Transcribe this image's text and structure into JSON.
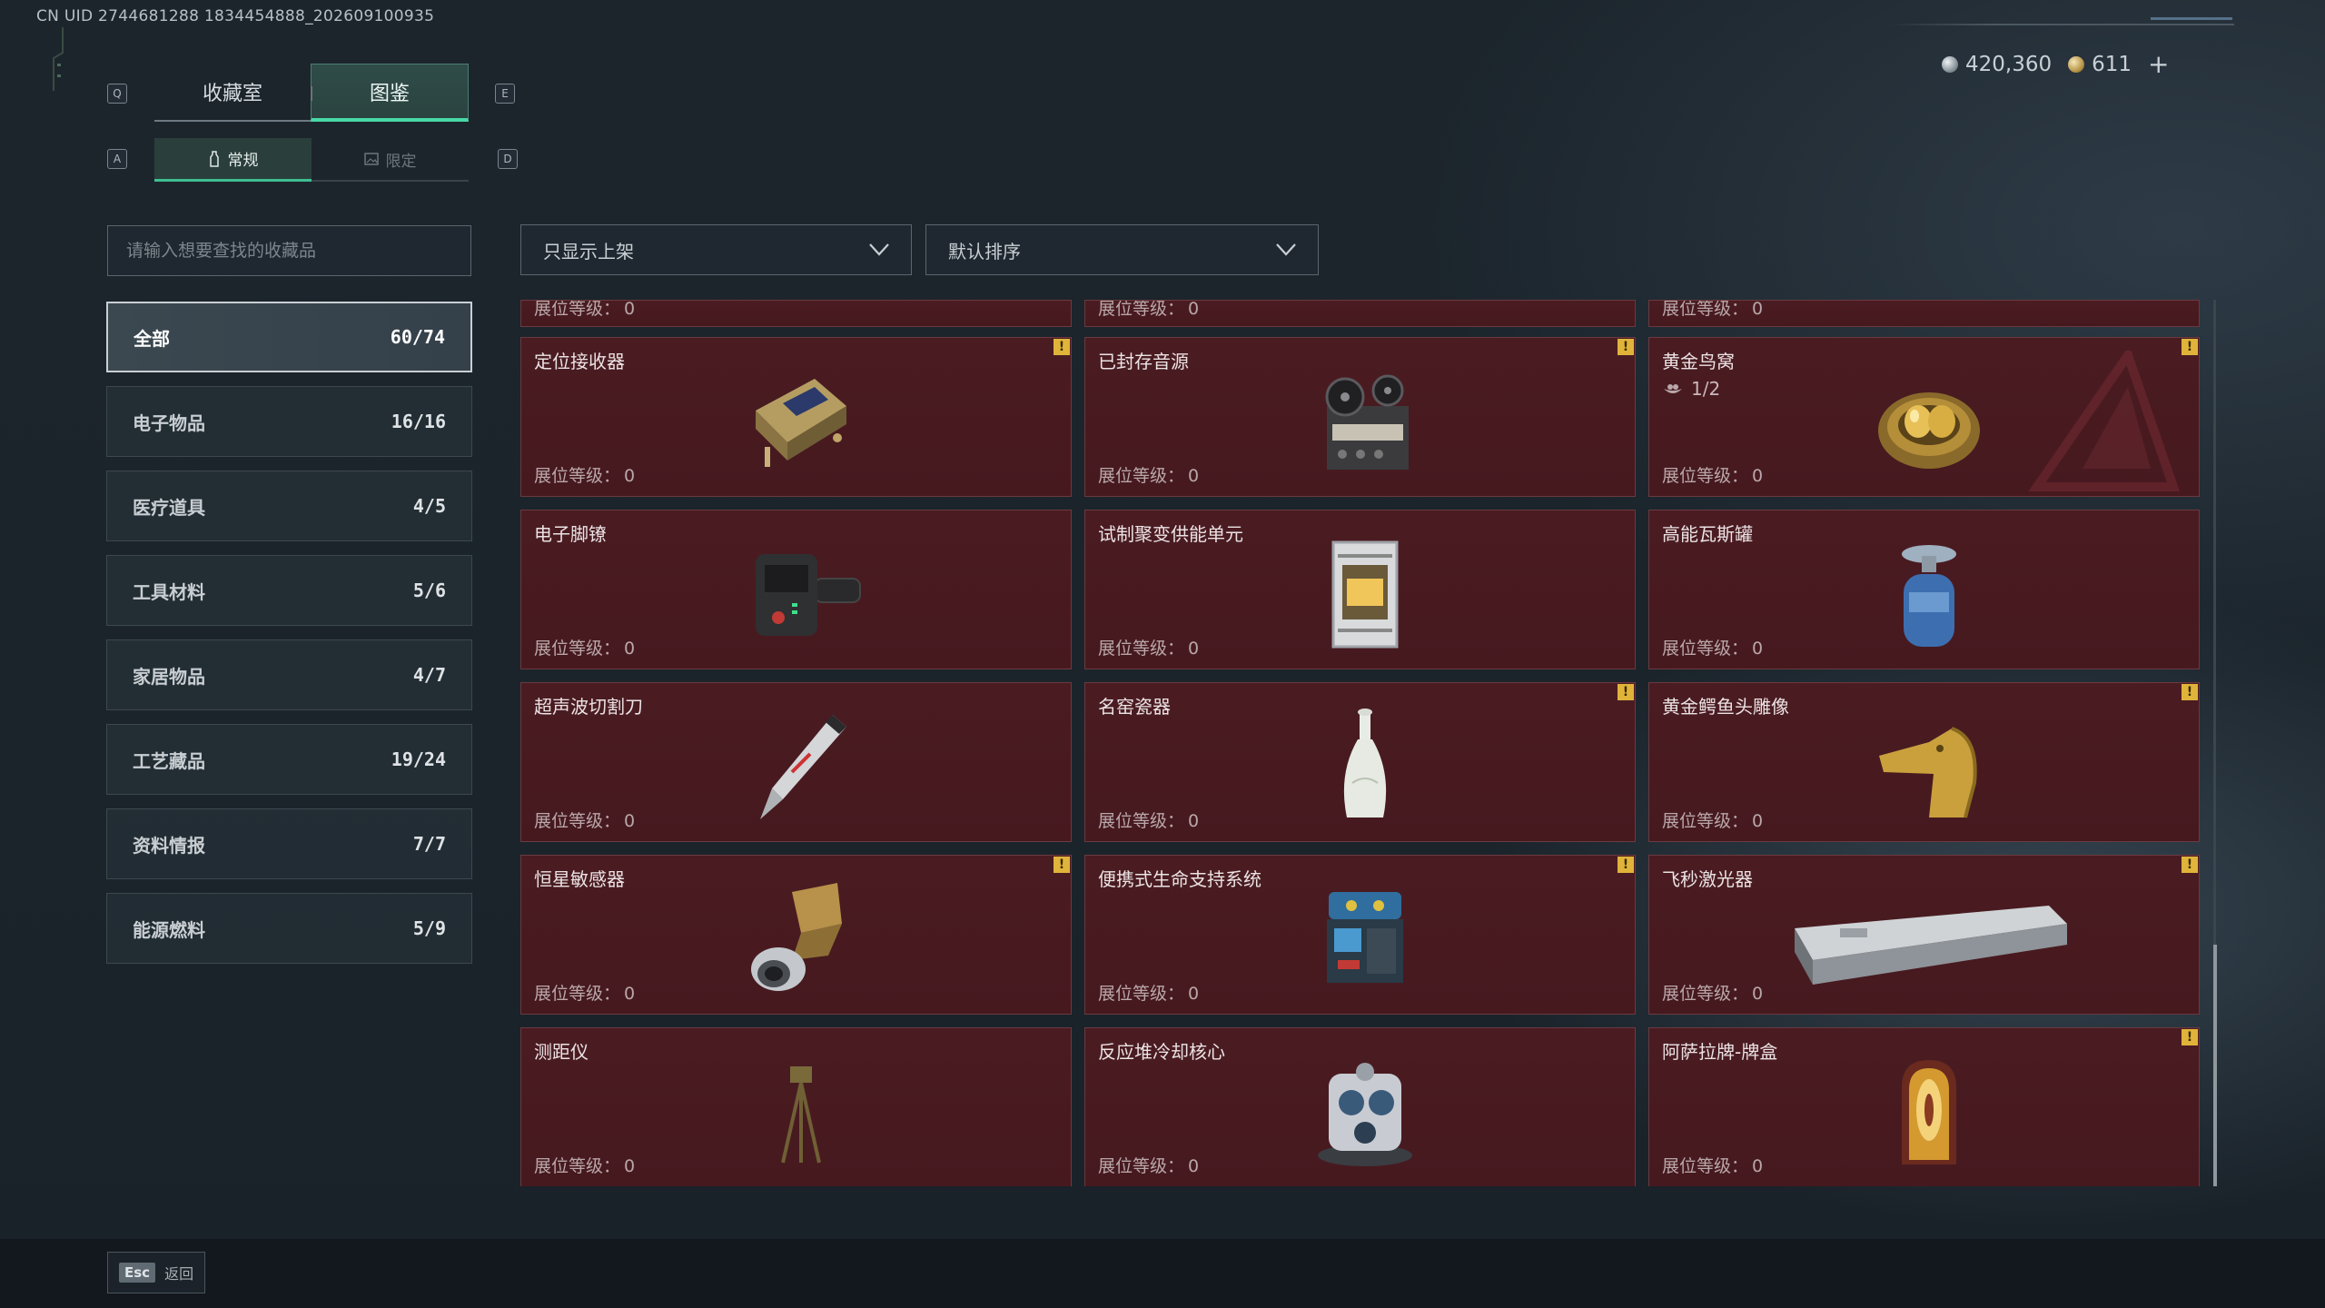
{
  "uid_text": "CN UID 2744681288 1834454888_202609100935",
  "hotkeys": {
    "prev_tab": "Q",
    "next_tab": "E",
    "prev_sub": "A",
    "next_sub": "D"
  },
  "tabs": [
    {
      "label": "收藏室",
      "active": false
    },
    {
      "label": "图鉴",
      "active": true
    }
  ],
  "sub_tabs": [
    {
      "label": "常规",
      "active": true
    },
    {
      "label": "限定",
      "active": false
    }
  ],
  "currency": {
    "silver": "420,360",
    "gold": "611",
    "add": "+"
  },
  "search": {
    "placeholder": "请输入想要查找的收藏品"
  },
  "categories": [
    {
      "name": "全部",
      "count": "60/74",
      "active": true
    },
    {
      "name": "电子物品",
      "count": "16/16"
    },
    {
      "name": "医疗道具",
      "count": "4/5"
    },
    {
      "name": "工具材料",
      "count": "5/6"
    },
    {
      "name": "家居物品",
      "count": "4/7"
    },
    {
      "name": "工艺藏品",
      "count": "19/24"
    },
    {
      "name": "资料情报",
      "count": "7/7"
    },
    {
      "name": "能源燃料",
      "count": "5/9"
    }
  ],
  "filters": {
    "show": "只显示上架",
    "sort": "默认排序"
  },
  "level_label": "展位等级：",
  "partial_row": [
    {
      "level": "0"
    },
    {
      "level": "0"
    },
    {
      "level": "0"
    }
  ],
  "items": [
    {
      "name": "定位接收器",
      "level": "0",
      "badge": "!",
      "icon": "receiver-icon"
    },
    {
      "name": "已封存音源",
      "level": "0",
      "badge": "!",
      "icon": "reel-recorder-icon"
    },
    {
      "name": "黄金鸟窝",
      "level": "0",
      "badge": "!",
      "icon": "golden-nest-icon",
      "progress": "1/2"
    },
    {
      "name": "电子脚镣",
      "level": "0",
      "icon": "ankle-monitor-icon"
    },
    {
      "name": "试制聚变供能单元",
      "level": "0",
      "icon": "fusion-cell-icon"
    },
    {
      "name": "高能瓦斯罐",
      "level": "0",
      "icon": "gas-canister-icon"
    },
    {
      "name": "超声波切割刀",
      "level": "0",
      "icon": "ultrasonic-cutter-icon"
    },
    {
      "name": "名窑瓷器",
      "level": "0",
      "badge": "!",
      "icon": "porcelain-vase-icon"
    },
    {
      "name": "黄金鳄鱼头雕像",
      "level": "0",
      "badge": "!",
      "icon": "gold-croc-statue-icon"
    },
    {
      "name": "恒星敏感器",
      "level": "0",
      "badge": "!",
      "icon": "star-sensor-icon"
    },
    {
      "name": "便携式生命支持系统",
      "level": "0",
      "badge": "!",
      "icon": "life-support-icon"
    },
    {
      "name": "飞秒激光器",
      "level": "0",
      "badge": "!",
      "icon": "femtosecond-laser-icon"
    },
    {
      "name": "测距仪",
      "level": "0",
      "icon": "rangefinder-icon"
    },
    {
      "name": "反应堆冷却核心",
      "level": "0",
      "icon": "reactor-core-icon"
    },
    {
      "name": "阿萨拉牌-牌盒",
      "level": "0",
      "badge": "!",
      "icon": "card-box-icon"
    }
  ],
  "footer": {
    "esc_key": "Esc",
    "back_label": "返回"
  },
  "colors": {
    "accent": "#48d9a6",
    "card_bg": "#4a1c22",
    "badge": "#e0b43a"
  }
}
